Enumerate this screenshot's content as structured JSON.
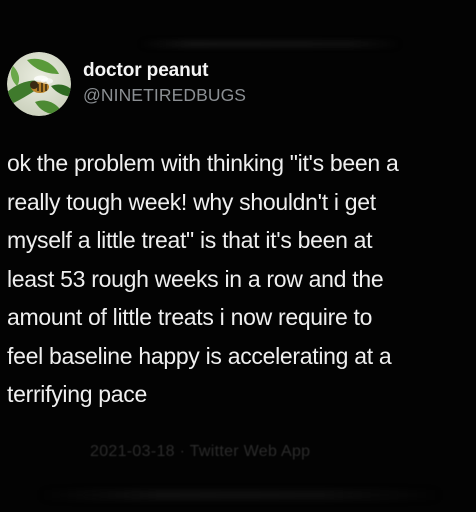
{
  "tweet": {
    "author": {
      "display_name": "doctor peanut",
      "handle": "@NINETIREDBUGS",
      "avatar_icon": "avatar-bee-on-leaves"
    },
    "text": "ok the problem with thinking \"it's been a\nreally tough week! why shouldn't i get\nmyself a little treat\" is that it's been at\nleast 53 rough weeks in a row and the\namount of little treats i now require to\nfeel baseline happy is accelerating at a\nterrifying pace",
    "timestamp_source": "2021-03-18 · Twitter Web App"
  },
  "colors": {
    "background": "#030303",
    "text": "#efefef",
    "handle": "#8b8f93"
  }
}
